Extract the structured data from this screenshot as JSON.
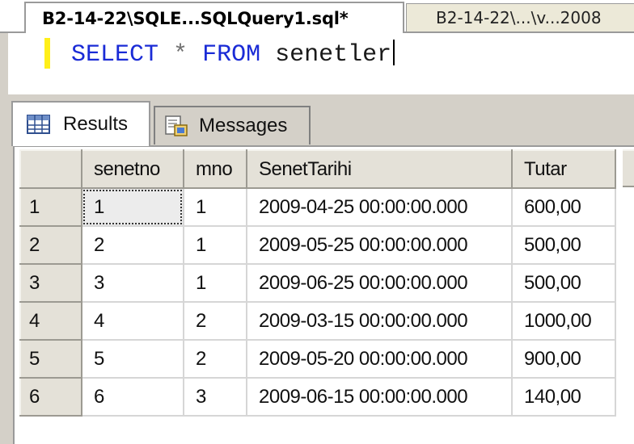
{
  "tabs": {
    "active": "B2-14-22\\SQLE...SQLQuery1.sql*",
    "inactive": "B2-14-22\\...\\v...2008"
  },
  "editor": {
    "kw_select": "SELECT",
    "op_star": "*",
    "kw_from": "FROM",
    "table": "senetler"
  },
  "result_tabs": {
    "results": "Results",
    "messages": "Messages"
  },
  "grid": {
    "columns": [
      "senetno",
      "mno",
      "SenetTarihi",
      "Tutar"
    ],
    "rows": [
      {
        "n": "1",
        "senetno": "1",
        "mno": "1",
        "tarih": "2009-04-25 00:00:00.000",
        "tutar": "600,00"
      },
      {
        "n": "2",
        "senetno": "2",
        "mno": "1",
        "tarih": "2009-05-25 00:00:00.000",
        "tutar": "500,00"
      },
      {
        "n": "3",
        "senetno": "3",
        "mno": "1",
        "tarih": "2009-06-25 00:00:00.000",
        "tutar": "500,00"
      },
      {
        "n": "4",
        "senetno": "4",
        "mno": "2",
        "tarih": "2009-03-15 00:00:00.000",
        "tutar": "1000,00"
      },
      {
        "n": "5",
        "senetno": "5",
        "mno": "2",
        "tarih": "2009-05-20 00:00:00.000",
        "tutar": "900,00"
      },
      {
        "n": "6",
        "senetno": "6",
        "mno": "3",
        "tarih": "2009-06-15 00:00:00.000",
        "tutar": "140,00"
      }
    ]
  },
  "colors": {
    "keyword": "#1a2bd6",
    "change_marker": "#ffef1a",
    "chrome": "#d4d0c8"
  },
  "icons": {
    "results_tab": "grid-icon",
    "messages_tab": "messages-icon"
  }
}
